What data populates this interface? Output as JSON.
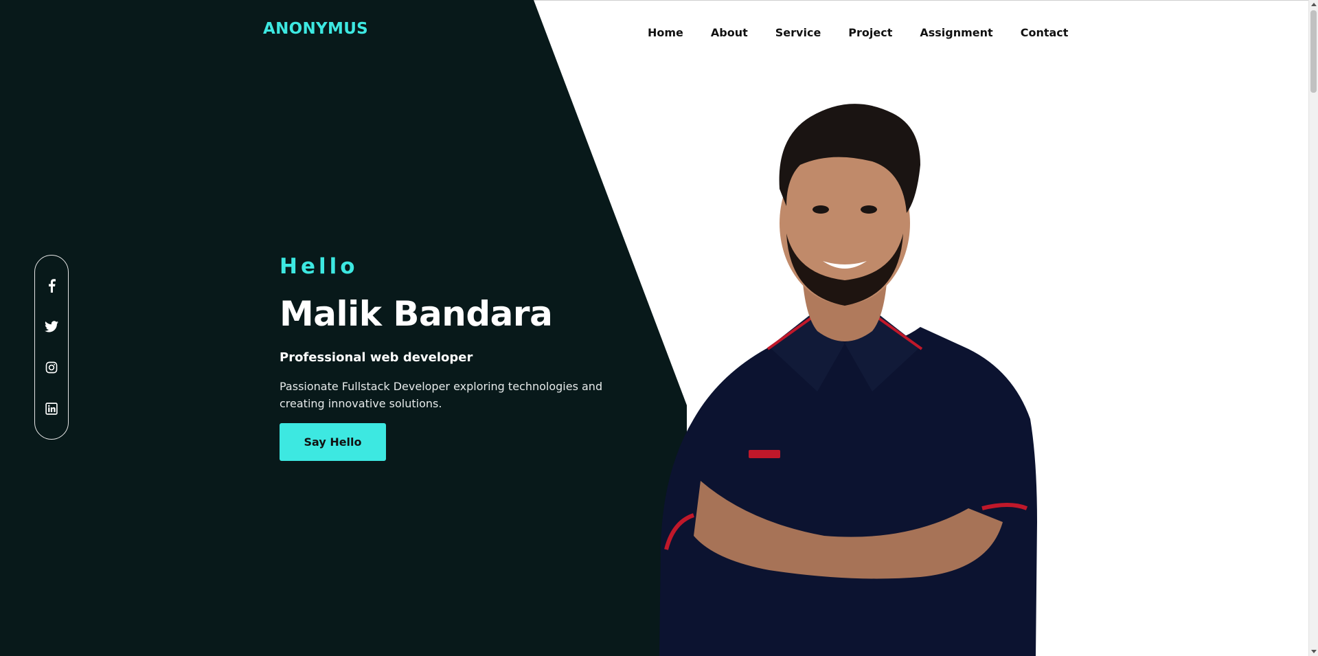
{
  "brand": {
    "logo": "ANONYMUS"
  },
  "nav": {
    "items": [
      {
        "label": "Home"
      },
      {
        "label": "About"
      },
      {
        "label": "Service"
      },
      {
        "label": "Project"
      },
      {
        "label": "Assignment"
      },
      {
        "label": "Contact"
      }
    ]
  },
  "social": {
    "icons": [
      "facebook-icon",
      "twitter-icon",
      "instagram-icon",
      "linkedin-icon"
    ]
  },
  "hero": {
    "greeting": "Hello",
    "name": "Malik Bandara",
    "role": "Professional web developer",
    "description": "Passionate Fullstack Developer exploring technologies and creating innovative solutions.",
    "cta_label": "Say Hello"
  },
  "colors": {
    "accent": "#3de8e1",
    "dark_bg": "#08191a",
    "light_bg": "#ffffff"
  }
}
